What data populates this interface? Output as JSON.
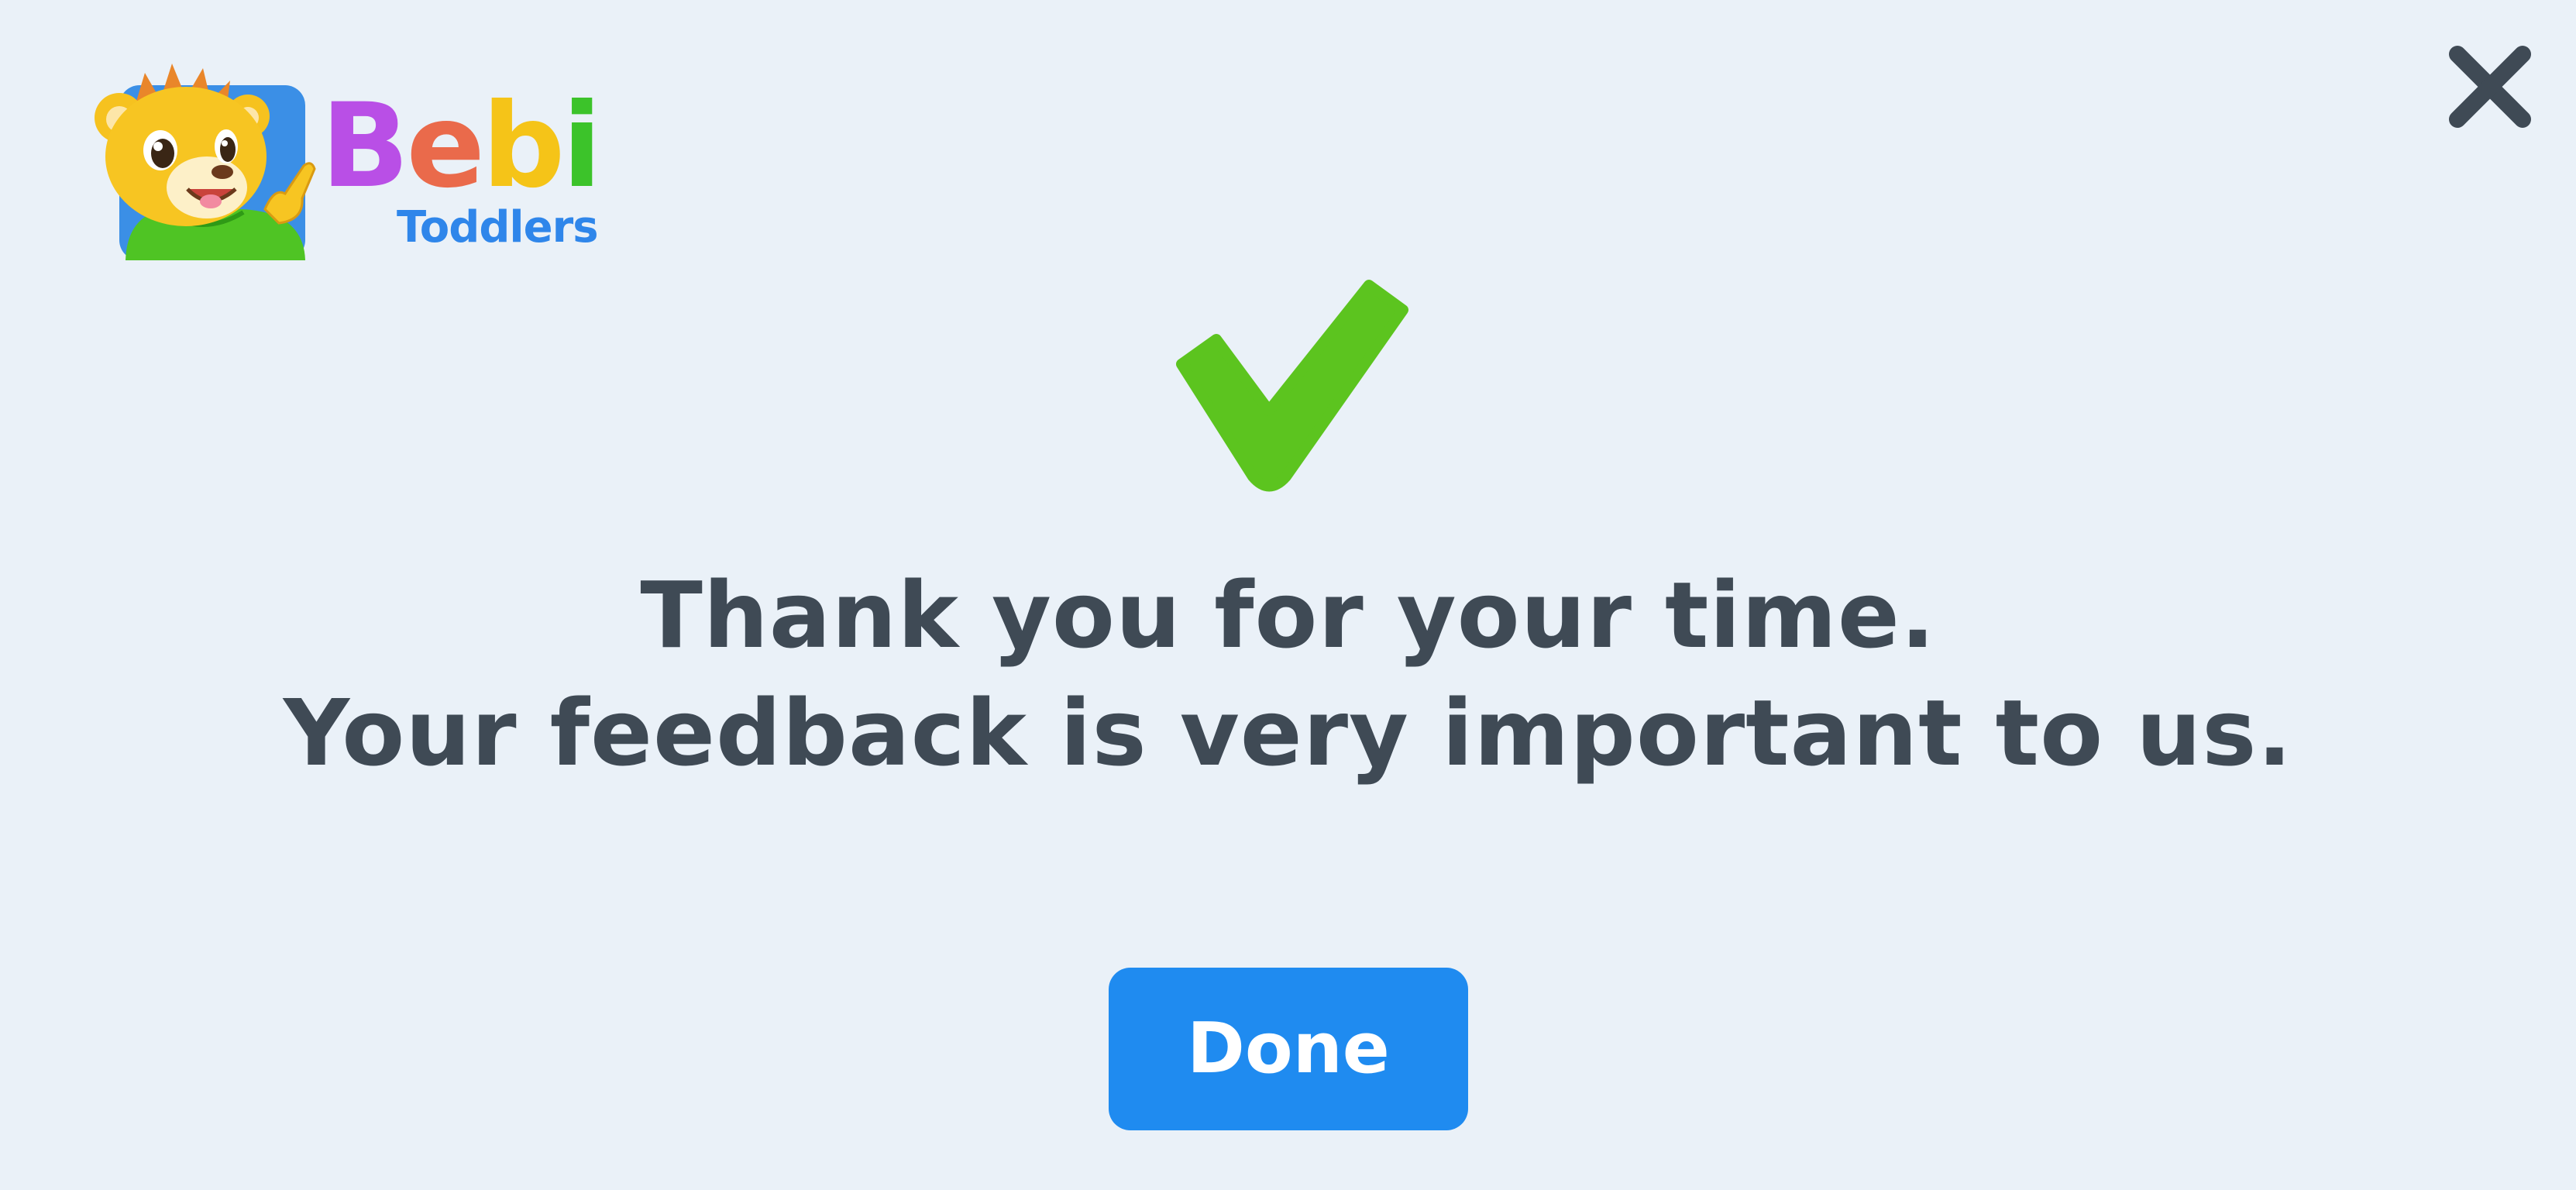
{
  "logo": {
    "brand_letters": [
      {
        "char": "B",
        "color": "#b94fe6"
      },
      {
        "char": "e",
        "color": "#ea6a4b"
      },
      {
        "char": "b",
        "color": "#f5c418"
      },
      {
        "char": "i",
        "color": "#3cc32a"
      }
    ],
    "subtitle": "Toddlers",
    "subtitle_color": "#2f86ea",
    "mascot_icon": "lion-cub-mascot-icon"
  },
  "close": {
    "icon": "close-icon",
    "color": "#3f4a55"
  },
  "confirmation": {
    "icon": "checkmark-icon",
    "icon_color": "#5cc41f",
    "line1": "Thank you for your time.",
    "line2": "Your feedback is very important to us."
  },
  "done_button": {
    "label": "Done",
    "color": "#1f8bf0"
  },
  "colors": {
    "background": "#eaf1f8",
    "text": "#3f4a55"
  }
}
